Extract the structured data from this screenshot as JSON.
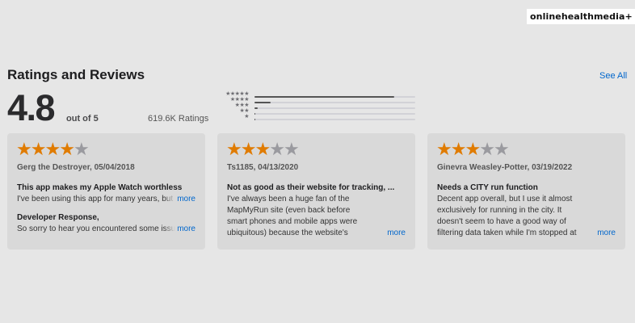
{
  "watermark": "onlinehealthmedia+",
  "section": {
    "title": "Ratings and Reviews",
    "see_all": "See All"
  },
  "summary": {
    "rating": "4.8",
    "out_of": "out of 5",
    "ratings_count": "619.6K Ratings"
  },
  "histogram": [
    {
      "stars": "★★★★★",
      "fraction": 0.87
    },
    {
      "stars": "★★★★",
      "fraction": 0.1
    },
    {
      "stars": "★★★",
      "fraction": 0.02
    },
    {
      "stars": "★★",
      "fraction": 0.005
    },
    {
      "stars": "★",
      "fraction": 0.005
    }
  ],
  "reviews": [
    {
      "rating": 4,
      "author_date": "Gerg the Destroyer, 05/04/2018",
      "title": "This app makes my Apple Watch worthless",
      "body": "I've been using this app for many years, but now that I got an Apple Watch it has become worthless.",
      "more": "more",
      "developer_response": {
        "label": "Developer Response,",
        "body": "So sorry to hear you encountered some issues with the Apple Watch app.",
        "more": "more"
      }
    },
    {
      "rating": 3,
      "author_date": "Ts1185, 04/13/2020",
      "title": "Not as good as their website for tracking, ...",
      "body": "I've always been a huge fan of the MapMyRun site (even back before smart phones and mobile apps were ubiquitous) because the website's ability to map out mileage for routes was great.",
      "more": "more"
    },
    {
      "rating": 3,
      "author_date": "Ginevra Weasley-Potter, 03/19/2022",
      "title": "Needs a CITY run function",
      "body": "Decent app overall, but I use it almost exclusively for running in the city. It doesn't seem to have a good way of filtering data taken while I'm stopped at traffic lights, which skews my pace.",
      "more": "more"
    }
  ],
  "colors": {
    "background": "#e6e6e6",
    "card": "#d9d9d9",
    "star_on": "#e07b00",
    "star_off": "#9a9a9f",
    "link": "#0066cc"
  }
}
